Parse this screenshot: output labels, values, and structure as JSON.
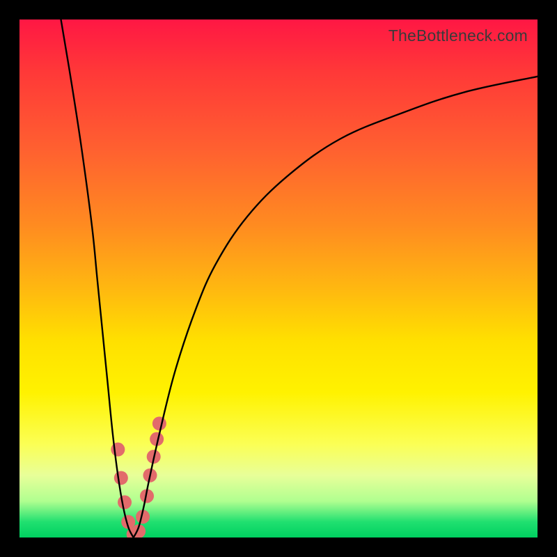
{
  "watermark": "TheBottleneck.com",
  "chart_data": {
    "type": "line",
    "title": "",
    "xlabel": "",
    "ylabel": "",
    "xlim": [
      0,
      100
    ],
    "ylim": [
      0,
      100
    ],
    "series": [
      {
        "name": "curve-left",
        "x": [
          8,
          10,
          12,
          14,
          15,
          16,
          17,
          18,
          19,
          20,
          21,
          22
        ],
        "y": [
          100,
          88,
          75,
          60,
          50,
          40,
          30,
          20,
          12,
          6,
          2,
          0
        ]
      },
      {
        "name": "curve-right",
        "x": [
          22,
          23,
          24,
          25,
          27,
          30,
          34,
          38,
          44,
          52,
          62,
          74,
          86,
          100
        ],
        "y": [
          0,
          2,
          6,
          11,
          20,
          32,
          44,
          53,
          62,
          70,
          77,
          82,
          86,
          89
        ]
      }
    ],
    "markers": {
      "name": "highlight-dots",
      "x": [
        19.0,
        19.6,
        20.3,
        21.0,
        22.0,
        23.0,
        23.8,
        24.6,
        25.2,
        25.9,
        26.5,
        27.0
      ],
      "y": [
        17.0,
        11.5,
        6.8,
        3.0,
        0.6,
        1.2,
        4.0,
        8.0,
        12.0,
        15.6,
        19.0,
        22.0
      ],
      "color": "#e26b6b",
      "radius": 10
    },
    "gradient_stops": [
      {
        "pct": 0,
        "color": "#ff1744"
      },
      {
        "pct": 10,
        "color": "#ff3838"
      },
      {
        "pct": 25,
        "color": "#ff6030"
      },
      {
        "pct": 40,
        "color": "#ff8c20"
      },
      {
        "pct": 52,
        "color": "#ffb810"
      },
      {
        "pct": 62,
        "color": "#ffe000"
      },
      {
        "pct": 72,
        "color": "#fff200"
      },
      {
        "pct": 82,
        "color": "#fbff55"
      },
      {
        "pct": 88,
        "color": "#e8ff99"
      },
      {
        "pct": 93,
        "color": "#b0ff90"
      },
      {
        "pct": 97,
        "color": "#20e070"
      },
      {
        "pct": 100,
        "color": "#00d060"
      }
    ]
  }
}
